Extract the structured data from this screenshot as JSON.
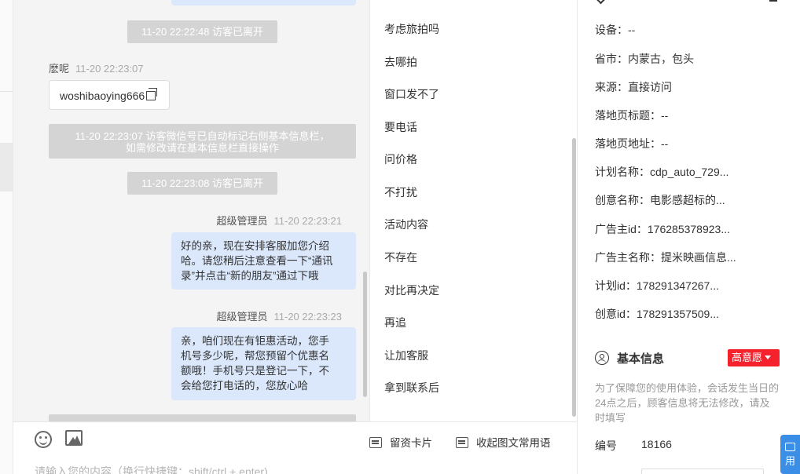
{
  "chat": {
    "system_messages": [
      "11-20 22:22:48 访客已离开",
      "11-20 22:23:07 访客微信号已自动标记右侧基本信息栏，",
      "如需修改请在基本信息栏直接操作",
      "11-20 22:23:08 访客已离开"
    ],
    "visitor_name": "麽呢",
    "visitor_time": "11-20 22:23:07",
    "wechat_card": "woshibaoying666",
    "agent_name": "超级管理员",
    "agent_time_1": "11-20 22:23:21",
    "agent_time_2": "11-20 22:23:23",
    "msg1": [
      "好的亲，现在安排客服加您介绍",
      "哈。请您稍后注意查看一下“通讯",
      "录”并点击“新的朋友”通过下哦"
    ],
    "msg2": [
      "亲，咱们现在有钜惠活动，您手",
      "机号多少呢，帮您预留个优惠名",
      "额哦！手机号只是登记一下，不",
      "会给您打电话的，您放心哈"
    ]
  },
  "input": {
    "leave_card": "留资卡片",
    "collapse_phrases": "收起图文常用语",
    "placeholder": "请输入您的内容（换行快捷键：shift/ctrl + enter)"
  },
  "replies": [
    "考虑旅拍吗",
    "去哪拍",
    "窗口发不了",
    "要电话",
    "问价格",
    "不打扰",
    "活动内容",
    "不存在",
    "对比再决定",
    "再追",
    "让加客服",
    "拿到联系后"
  ],
  "panel": {
    "rows": [
      "设备：--",
      "省市：内蒙古，包头",
      "来源：直接访问",
      "落地页标题：--",
      "落地页地址：--",
      "计划名称：cdp_auto_729...",
      "创意名称：电影感超标的...",
      "广告主id：176285378923...",
      "广告主名称：提米映画信息...",
      "计划id：178291347267...",
      "创意id：178291357509..."
    ],
    "section_title": "基本信息",
    "intent": "高意愿",
    "notice": "为了保障您的使用体验，会话发生当日的24点之后，顾客信息将无法修改，请及时填写",
    "id_label": "编号",
    "id_value": "18166",
    "float_label": "用"
  }
}
